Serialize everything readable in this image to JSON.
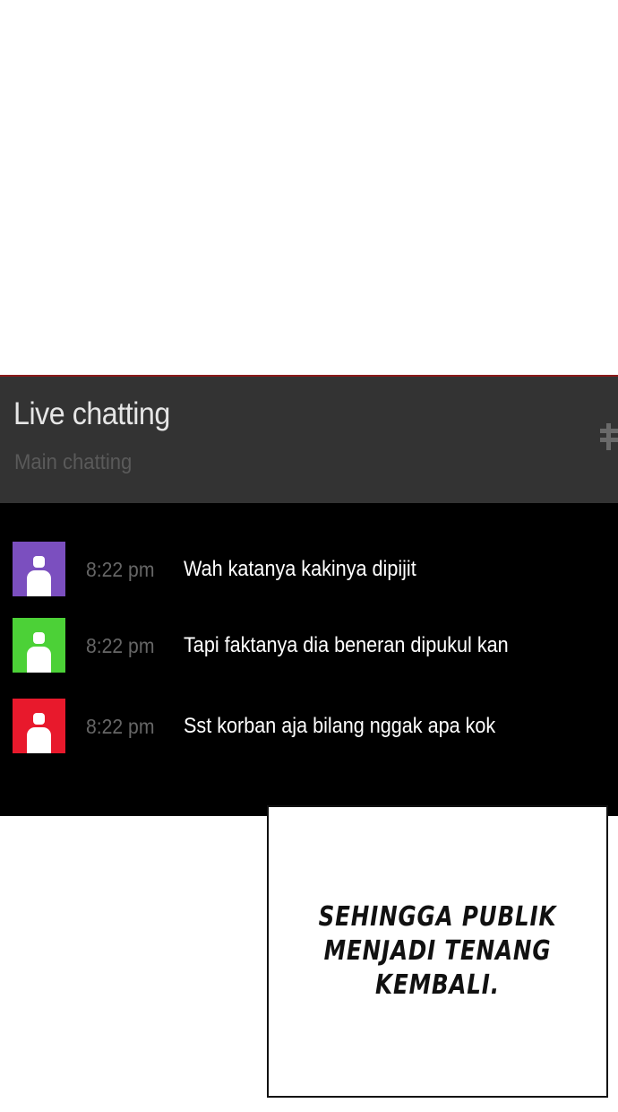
{
  "chat": {
    "title": "Live chatting",
    "subtitle": "Main chatting",
    "header_icon": "expand-icon",
    "messages": [
      {
        "time": "8:22 pm",
        "text": "Wah katanya kakinya dipijit",
        "avatar_color": "#7b4fbf",
        "avatar_icon": "user-icon"
      },
      {
        "time": "8:22 pm",
        "text": "Tapi faktanya dia beneran dipukul kan",
        "avatar_color": "#4cd137",
        "avatar_icon": "user-icon"
      },
      {
        "time": "8:22 pm",
        "text": "Sst korban aja bilang nggak apa kok",
        "avatar_color": "#e8192c",
        "avatar_icon": "user-icon"
      }
    ]
  },
  "caption": {
    "lines": [
      "SEHINGGA PUBLIK",
      "MENJADI TENANG",
      "KEMBALI."
    ]
  },
  "colors": {
    "panel_background": "#000000",
    "header_background": "#333333",
    "accent_border": "#8b1a1a"
  }
}
